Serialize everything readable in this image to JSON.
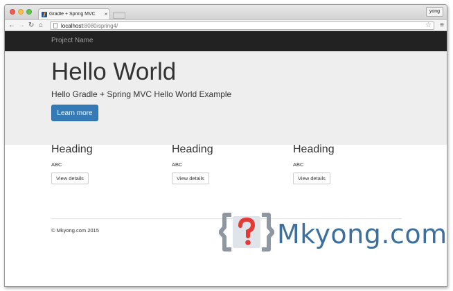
{
  "browser": {
    "tab_title": "Gradle + Spring MVC",
    "tab_close": "×",
    "user_name": "yong",
    "url_host": "localhost",
    "url_rest": ":8080/spring4/",
    "icons": {
      "back": "back-arrow-icon",
      "forward": "forward-arrow-icon",
      "reload": "reload-icon",
      "home": "home-icon",
      "star": "star-icon",
      "menu": "hamburger-menu-icon"
    }
  },
  "page": {
    "navbar": {
      "brand": "Project Name",
      "bg_color": "#222222"
    },
    "jumbotron": {
      "title": "Hello World",
      "lead": "Hello Gradle + Spring MVC Hello World Example",
      "button_label": "Learn more",
      "button_color": "#337ab7"
    },
    "columns": [
      {
        "heading": "Heading",
        "text": "ABC",
        "button_label": "View details"
      },
      {
        "heading": "Heading",
        "text": "ABC",
        "button_label": "View details"
      },
      {
        "heading": "Heading",
        "text": "ABC",
        "button_label": "View details"
      }
    ],
    "footer": "© Mkyong.com 2015"
  },
  "watermark": {
    "text": "Mkyong.com",
    "icon": "question-bracket-logo-icon",
    "colors": {
      "text": "#3c6f9e",
      "mark": "#e53935",
      "bracket": "#8e97a2"
    }
  }
}
